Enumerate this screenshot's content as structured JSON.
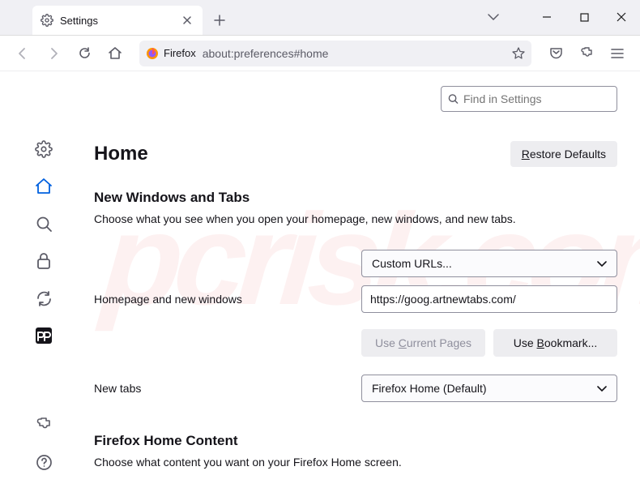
{
  "tab": {
    "title": "Settings"
  },
  "url": {
    "badge": "Firefox",
    "path": "about:preferences#home"
  },
  "search": {
    "placeholder": "Find in Settings"
  },
  "page": {
    "title": "Home",
    "restore": "Restore Defaults",
    "section1": {
      "heading": "New Windows and Tabs",
      "desc": "Choose what you see when you open your homepage, new windows, and new tabs."
    },
    "homepage": {
      "label": "Homepage and new windows",
      "dropdown": "Custom URLs...",
      "value": "https://goog.artnewtabs.com/",
      "btn1": "Use Current Pages",
      "btn2": "Use Bookmark..."
    },
    "newtabs": {
      "label": "New tabs",
      "dropdown": "Firefox Home (Default)"
    },
    "section2": {
      "heading": "Firefox Home Content",
      "desc": "Choose what content you want on your Firefox Home screen."
    }
  },
  "watermark": "pcrisk.com"
}
